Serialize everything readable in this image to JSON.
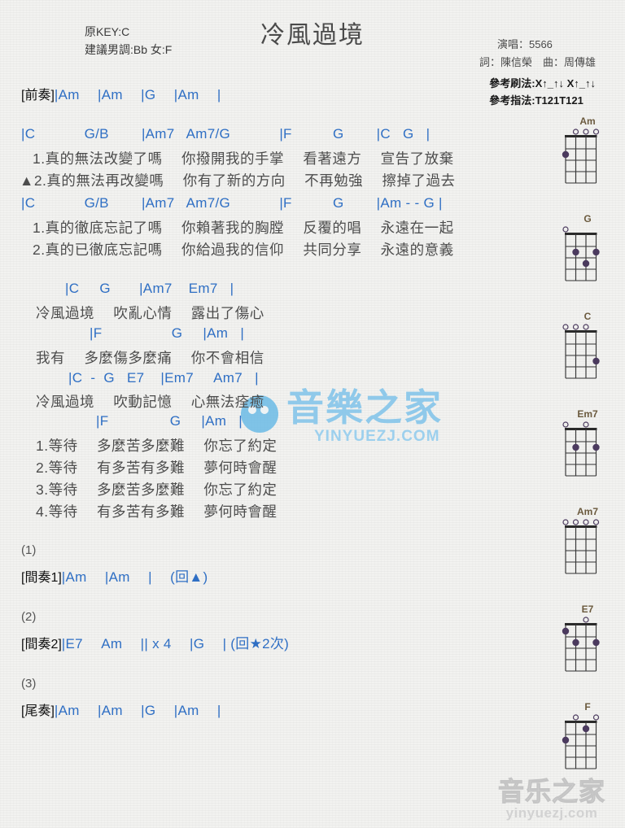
{
  "header": {
    "title": "冷風過境",
    "original_key": "原KEY:C",
    "suggested_key": "建議男調:Bb 女:F",
    "singer": "演唱：5566",
    "credits": "詞：陳信榮　曲：周傳雄",
    "strum_ref": "參考刷法:X↑_↑↓ X↑_↑↓",
    "finger_ref": "參考指法:T121T121"
  },
  "intro": {
    "label": "[前奏]",
    "chords": "|Am　 |Am 　|G 　|Am 　|"
  },
  "verse1": {
    "chordline": "|C            G/B        |Am7   Am7/G            |F          G        |C   G   |",
    "lyric1": "1.真的無法改變了嗎 　你撥開我的手掌 　看著遠方 　宣告了放棄",
    "lyric2": "▲2.真的無法再改變嗎 　你有了新的方向 　不再勉強 　擦掉了過去"
  },
  "verse2": {
    "chordline": "|C            G/B        |Am7   Am7/G            |F          G        |Am - - G |",
    "lyric1": "1.真的徹底忘記了嗎 　你賴著我的胸膛 　反覆的唱 　永遠在一起",
    "lyric2": "2.真的已徹底忘記嗎 　你給過我的信仰 　共同分享 　永遠的意義"
  },
  "chorus": {
    "line1_chords": "|C     G       |Am7    Em7   |",
    "line1_lyric": "冷風過境 　吹亂心情 　露出了傷心",
    "line2_chords": "|F                 G     |Am   |",
    "line2_lyric": "我有 　多麼傷多麼痛 　你不會相信",
    "line3_chords": "|C  -  G   E7    |Em7     Am7   |",
    "line3_lyric": "冷風過境 　吹動記憶 　心無法痊癒",
    "line4_chords": "|F               G     |Am   |",
    "line4_lyrics": [
      "1.等待 　多麼苦多麼難 　你忘了約定",
      "2.等待 　有多苦有多難 　夢何時會醒",
      "3.等待 　多麼苦多麼難 　你忘了約定",
      "4.等待 　有多苦有多難 　夢何時會醒"
    ]
  },
  "interlude1": {
    "num": "(1)",
    "label": "[間奏1]",
    "chords": "|Am 　|Am 　| 　(回▲)"
  },
  "interlude2": {
    "num": "(2)",
    "label": "[間奏2]",
    "chords": "|E7 　Am 　|| x 4 　|G 　| (回★2次)"
  },
  "outro": {
    "num": "(3)",
    "label": "[尾奏]",
    "chords": "|Am 　|Am 　|G 　|Am 　|"
  },
  "diagrams": [
    {
      "name": "Am",
      "open": [
        0,
        1,
        1,
        1
      ],
      "dots": [
        {
          "string": 0,
          "fret": 2
        }
      ]
    },
    {
      "name": "G",
      "open": [
        1,
        0,
        0,
        0
      ],
      "dots": [
        {
          "string": 1,
          "fret": 2
        },
        {
          "string": 2,
          "fret": 3
        },
        {
          "string": 3,
          "fret": 2
        }
      ]
    },
    {
      "name": "C",
      "open": [
        1,
        1,
        1,
        0
      ],
      "dots": [
        {
          "string": 3,
          "fret": 3
        }
      ]
    },
    {
      "name": "Em7",
      "open": [
        1,
        0,
        1,
        0
      ],
      "dots": [
        {
          "string": 1,
          "fret": 2
        },
        {
          "string": 3,
          "fret": 2
        }
      ]
    },
    {
      "name": "Am7",
      "open": [
        1,
        1,
        1,
        1
      ],
      "dots": []
    },
    {
      "name": "E7",
      "open": [
        0,
        0,
        1,
        0
      ],
      "dots": [
        {
          "string": 0,
          "fret": 1
        },
        {
          "string": 1,
          "fret": 2
        },
        {
          "string": 3,
          "fret": 2
        }
      ]
    },
    {
      "name": "F",
      "open": [
        0,
        1,
        0,
        1
      ],
      "dots": [
        {
          "string": 2,
          "fret": 1
        },
        {
          "string": 0,
          "fret": 2
        }
      ]
    }
  ],
  "watermarks": {
    "middle_cn": "音樂之家",
    "middle_en": "YINYUEZJ.COM",
    "bottom_cn": "音乐之家",
    "bottom_en": "yinyuezj.com"
  },
  "colors": {
    "chord": "#2f6fc4",
    "lyric": "#4d4d4d",
    "title": "#4a4a4a",
    "diagram_dot": "#4b3a5e",
    "diagram_name": "#6b5a3e",
    "watermark_blue": "#7fc3ea",
    "watermark_gray": "#d7d7d7"
  }
}
